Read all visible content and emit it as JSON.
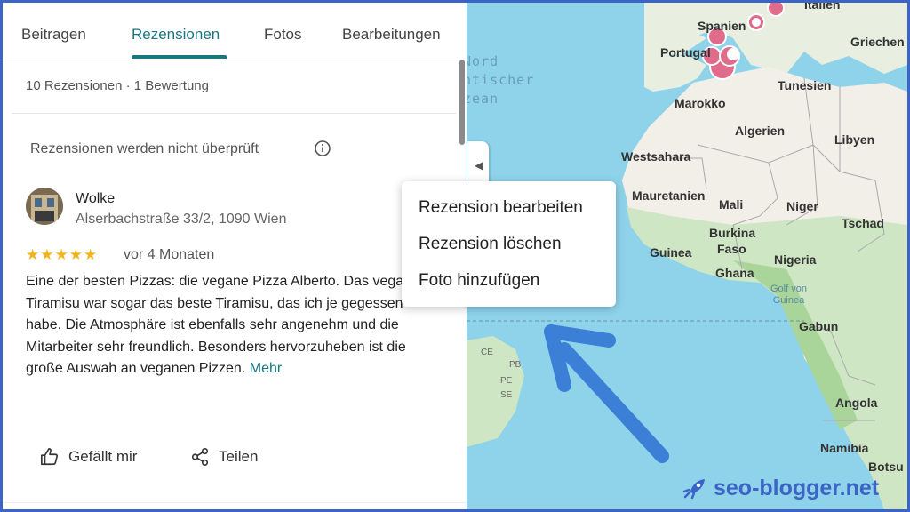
{
  "tabs": [
    {
      "label": "Beitragen"
    },
    {
      "label": "Rezensionen"
    },
    {
      "label": "Fotos"
    },
    {
      "label": "Bearbeitungen"
    }
  ],
  "summary": "10 Rezensionen · 1 Bewertung",
  "notice": "Rezensionen werden nicht überprüft",
  "review": {
    "author": "Wolke",
    "address": "Alserbachstraße 33/2, 1090 Wien",
    "stars": "★★★★★",
    "rating": 5,
    "time": "vor 4 Monaten",
    "text": "Eine der besten Pizzas: die vegane Pizza Alberto. Das vegane Tiramisu war sogar das beste Tiramisu, das ich je gegessen habe. Die Atmosphäre ist ebenfalls sehr angenehm und die Mitarbeiter sehr freundlich. Besonders hervorzuheben ist die große Auswah an veganen Pizzen.",
    "more": "Mehr"
  },
  "actions": {
    "like": "Gefällt mir",
    "share": "Teilen"
  },
  "menu": [
    {
      "label": "Rezension bearbeiten"
    },
    {
      "label": "Rezension löschen"
    },
    {
      "label": "Foto hinzufügen"
    }
  ],
  "map": {
    "ocean": [
      "Nord",
      "ntischer",
      "zean"
    ],
    "countries": [
      "Italien",
      "Spanien",
      "Griechen",
      "Portugal",
      "Tunesien",
      "Marokko",
      "Algerien",
      "Libyen",
      "Westsahara",
      "Mauretanien",
      "Mali",
      "Niger",
      "Tschad",
      "Burkina",
      "Faso",
      "Guinea",
      "Ghana",
      "Nigeria",
      "Gabun",
      "Angola",
      "Namibia",
      "Botsu"
    ],
    "gulf": [
      "Golf von",
      "Guinea"
    ],
    "brazil_states": [
      "CE",
      "PB",
      "PE",
      "SE"
    ]
  },
  "watermark": "seo-blogger.net",
  "colors": {
    "accent": "#1a7682",
    "frame": "#3b64c6",
    "star": "#f3b41b",
    "land": "#f2efe9",
    "ocean": "#8fd3ea",
    "arrow": "#3b7fd6"
  }
}
